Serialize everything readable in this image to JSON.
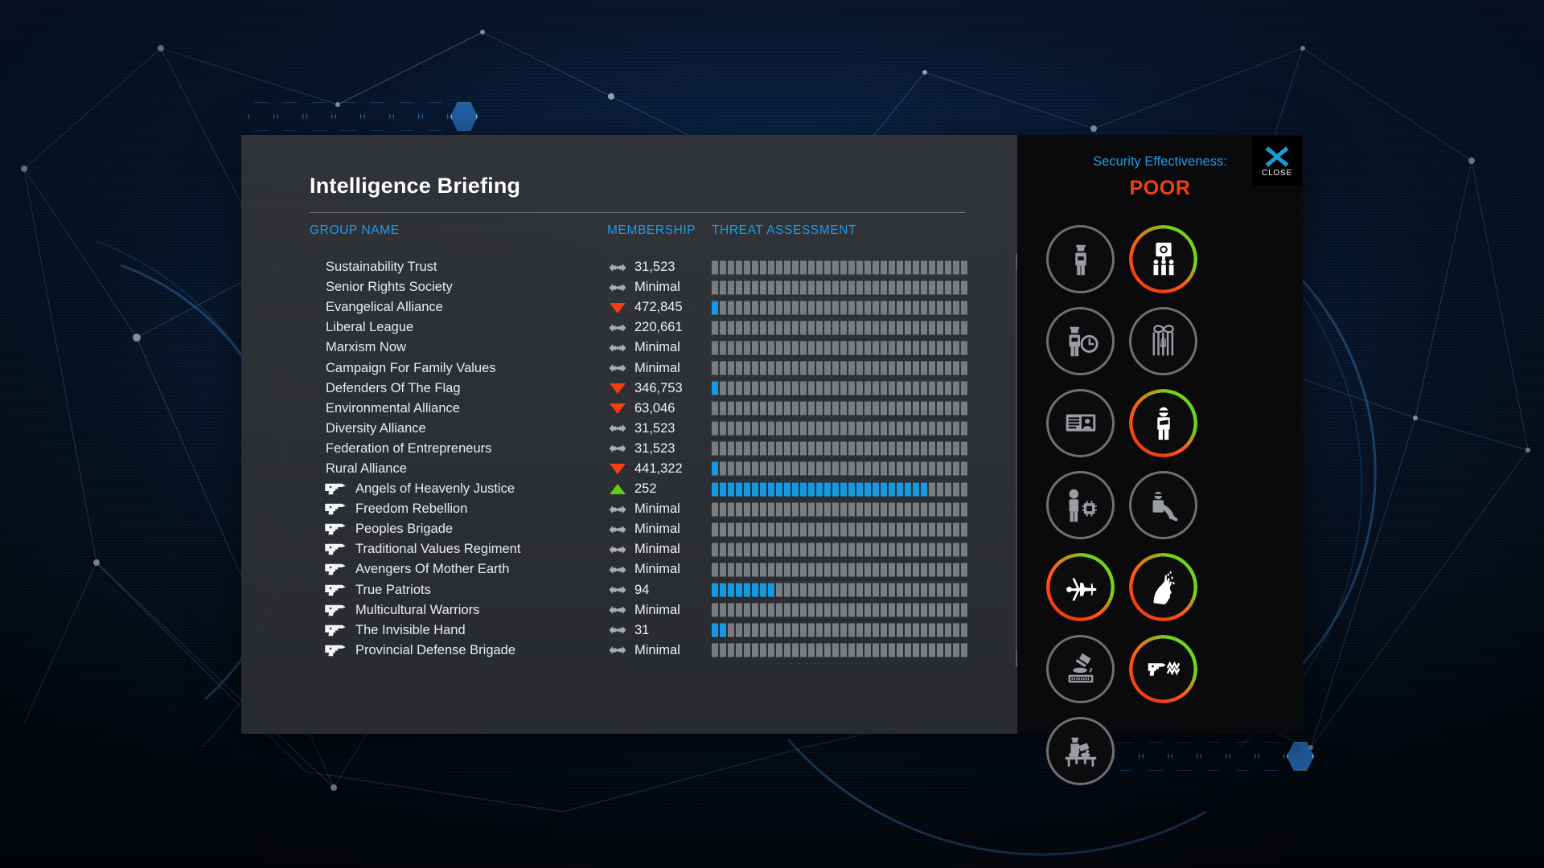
{
  "window": {
    "title": "Intelligence Briefing"
  },
  "columns": {
    "group_name": "GROUP NAME",
    "membership": "MEMBERSHIP",
    "threat": "THREAT ASSESSMENT"
  },
  "threat_segments_total": 32,
  "groups": [
    {
      "name": "Sustainability Trust",
      "armed": false,
      "trend": "flat",
      "membership": "31,523",
      "threat_filled": 0
    },
    {
      "name": "Senior Rights Society",
      "armed": false,
      "trend": "flat",
      "membership": "Minimal",
      "threat_filled": 0
    },
    {
      "name": "Evangelical Alliance",
      "armed": false,
      "trend": "down",
      "membership": "472,845",
      "threat_filled": 1
    },
    {
      "name": "Liberal League",
      "armed": false,
      "trend": "flat",
      "membership": "220,661",
      "threat_filled": 0
    },
    {
      "name": "Marxism Now",
      "armed": false,
      "trend": "flat",
      "membership": "Minimal",
      "threat_filled": 0
    },
    {
      "name": "Campaign For Family Values",
      "armed": false,
      "trend": "flat",
      "membership": "Minimal",
      "threat_filled": 0
    },
    {
      "name": "Defenders Of The Flag",
      "armed": false,
      "trend": "down",
      "membership": "346,753",
      "threat_filled": 1
    },
    {
      "name": "Environmental Alliance",
      "armed": false,
      "trend": "down",
      "membership": "63,046",
      "threat_filled": 0
    },
    {
      "name": "Diversity Alliance",
      "armed": false,
      "trend": "flat",
      "membership": "31,523",
      "threat_filled": 0
    },
    {
      "name": "Federation of Entrepreneurs",
      "armed": false,
      "trend": "flat",
      "membership": "31,523",
      "threat_filled": 0
    },
    {
      "name": "Rural Alliance",
      "armed": false,
      "trend": "down",
      "membership": "441,322",
      "threat_filled": 1
    },
    {
      "name": "Angels of Heavenly Justice",
      "armed": true,
      "trend": "up",
      "membership": "252",
      "threat_filled": 27
    },
    {
      "name": "Freedom Rebellion",
      "armed": true,
      "trend": "flat",
      "membership": "Minimal",
      "threat_filled": 0
    },
    {
      "name": "Peoples Brigade",
      "armed": true,
      "trend": "flat",
      "membership": "Minimal",
      "threat_filled": 0
    },
    {
      "name": "Traditional Values Regiment",
      "armed": true,
      "trend": "flat",
      "membership": "Minimal",
      "threat_filled": 0
    },
    {
      "name": "Avengers Of Mother Earth",
      "armed": true,
      "trend": "flat",
      "membership": "Minimal",
      "threat_filled": 0
    },
    {
      "name": "True Patriots",
      "armed": true,
      "trend": "flat",
      "membership": "94",
      "threat_filled": 8
    },
    {
      "name": "Multicultural Warriors",
      "armed": true,
      "trend": "flat",
      "membership": "Minimal",
      "threat_filled": 0
    },
    {
      "name": "The Invisible Hand",
      "armed": true,
      "trend": "flat",
      "membership": "31",
      "threat_filled": 2
    },
    {
      "name": "Provincial Defense Brigade",
      "armed": true,
      "trend": "flat",
      "membership": "Minimal",
      "threat_filled": 0
    }
  ],
  "scrollbar": {
    "up_arrow": "scroll-up",
    "down_arrow": "scroll-down"
  },
  "security": {
    "label": "Security Effectiveness:",
    "value": "POOR",
    "value_color": "#f43f10",
    "label_color": "#1e9ce8"
  },
  "close": {
    "label": "CLOSE",
    "icon": "close-x-icon",
    "color": "#199ad9"
  },
  "security_options": [
    {
      "icon": "police-officer-icon",
      "active": false
    },
    {
      "icon": "security-camera-crowd-icon",
      "active": true
    },
    {
      "icon": "officer-clock-icon",
      "active": false
    },
    {
      "icon": "prison-bars-hand-icon",
      "active": false
    },
    {
      "icon": "id-card-icon",
      "active": false
    },
    {
      "icon": "masked-person-icon",
      "active": true
    },
    {
      "icon": "person-microchip-icon",
      "active": false
    },
    {
      "icon": "wiretap-phone-icon",
      "active": false
    },
    {
      "icon": "surveillance-drone-icon",
      "active": true
    },
    {
      "icon": "hand-grab-icon",
      "active": true
    },
    {
      "icon": "gavel-censorship-icon",
      "active": false
    },
    {
      "icon": "pistol-signal-icon",
      "active": true
    },
    {
      "icon": "checkpoint-search-icon",
      "active": false
    }
  ],
  "colors": {
    "accent_blue": "#1e9ce8",
    "bar_blue": "#159ae2",
    "bar_grey": "#7a7d80",
    "alert_red": "#f43f10",
    "ok_green": "#6fd41a",
    "panel_bg": "#2e3034",
    "right_panel_bg": "#0a0a0c"
  }
}
